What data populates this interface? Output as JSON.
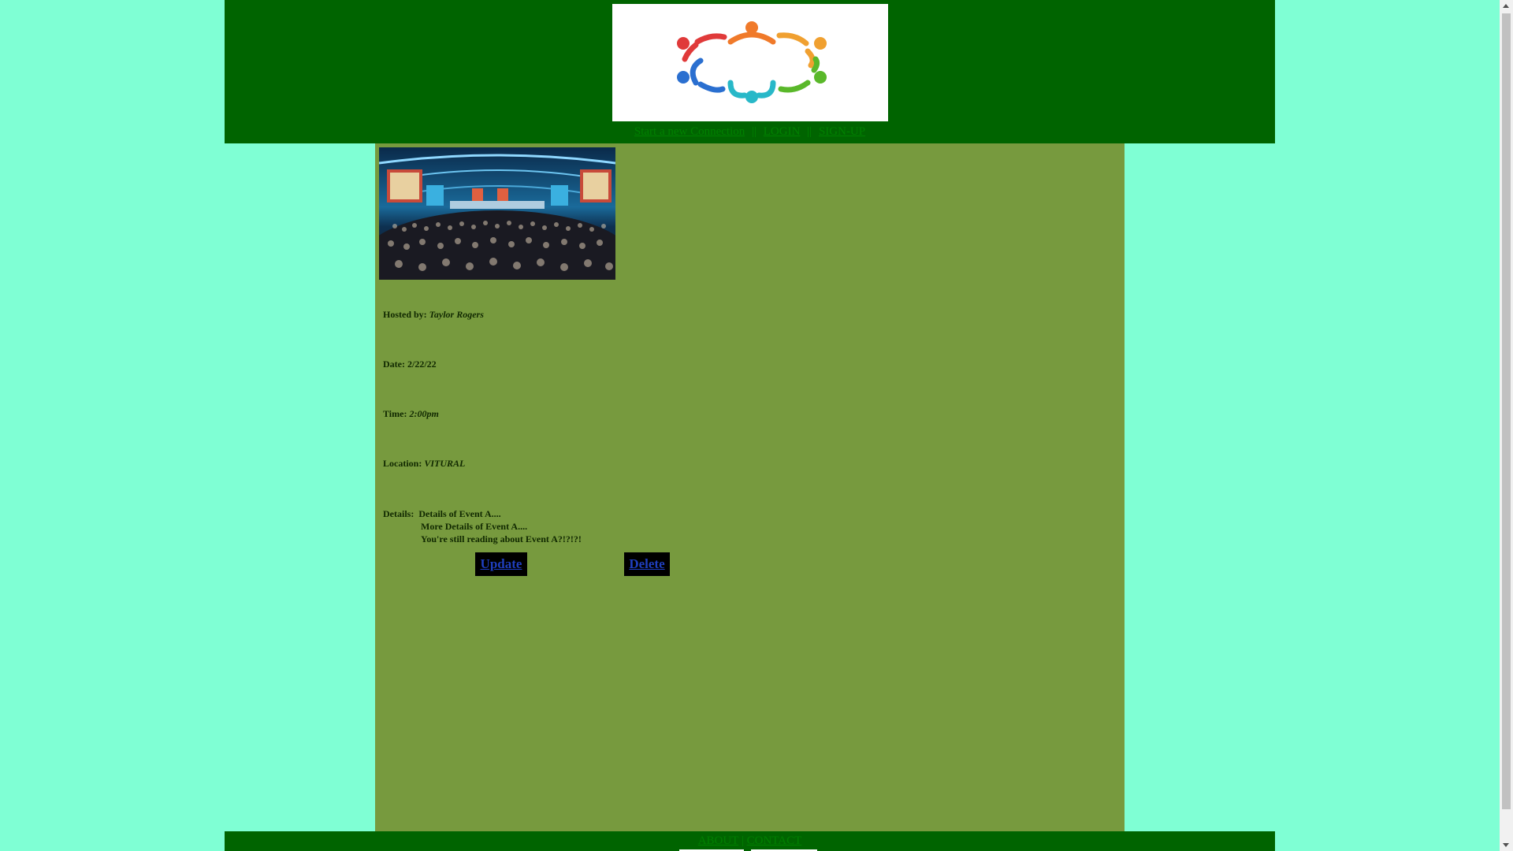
{
  "header": {
    "nav": {
      "start_connection": "Start a new Connection",
      "separator": "||",
      "login": "LOGIN",
      "signup": "SIGN-UP"
    }
  },
  "event": {
    "hosted_label": "Hosted by:",
    "hosted_value": "Taylor Rogers",
    "date_label": "Date:",
    "date_value": "2/22/22",
    "time_label": "Time:",
    "time_value": "2:00pm",
    "location_label": "Location:",
    "location_value": "VITURAL",
    "details_label": "Details:",
    "details_lines": [
      "Details of Event A....",
      "More Details of Event A....",
      "You're still reading about Event A?!?!?!"
    ]
  },
  "actions": {
    "update_label": "Update",
    "delete_label": "Delete"
  },
  "footer": {
    "about": "ABOUT",
    "separator": "|",
    "contact": "CONTACT"
  },
  "colors": {
    "page_bg": "#7fffd4",
    "header_bg": "#006400",
    "main_bg": "#779a3e",
    "link": "#008000",
    "button_bg": "#000000",
    "button_text": "#1f3fbf"
  },
  "icons": {
    "logo": "people-circle-logo-icon",
    "event_image": "conference-audience-image"
  }
}
